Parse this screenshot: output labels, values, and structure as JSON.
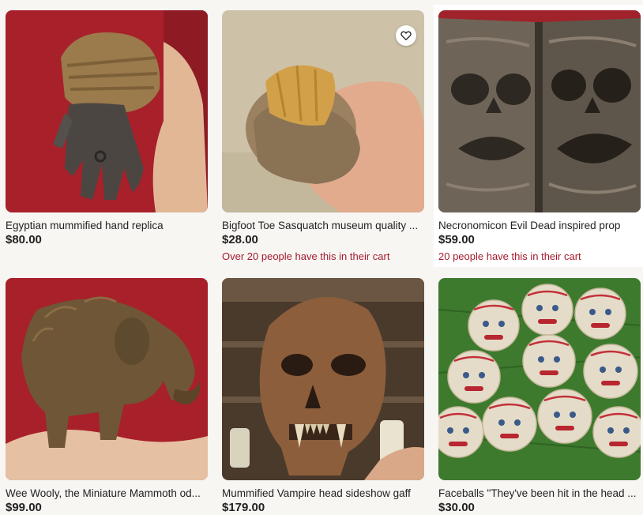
{
  "listings": [
    {
      "title": "Egyptian mummified hand replica",
      "price": "$80.00",
      "cart_note": ""
    },
    {
      "title": "Bigfoot Toe Sasquatch museum quality ...",
      "price": "$28.00",
      "cart_note": "Over 20 people have this in their cart"
    },
    {
      "title": "Necronomicon Evil Dead inspired prop",
      "price": "$59.00",
      "cart_note": "20 people have this in their cart"
    },
    {
      "title": "Wee Wooly, the Miniature Mammoth od...",
      "price": "$99.00",
      "cart_note": ""
    },
    {
      "title": "Mummified Vampire head sideshow gaff",
      "price": "$179.00",
      "cart_note": ""
    },
    {
      "title": "Faceballs \"They've been hit in the head ...",
      "price": "$30.00",
      "cart_note": ""
    }
  ],
  "icons": {
    "favorite": "heart-outline-icon"
  },
  "colors": {
    "cart_note": "#a61a2e",
    "price": "#222222",
    "page_bg": "#f7f6f3"
  }
}
